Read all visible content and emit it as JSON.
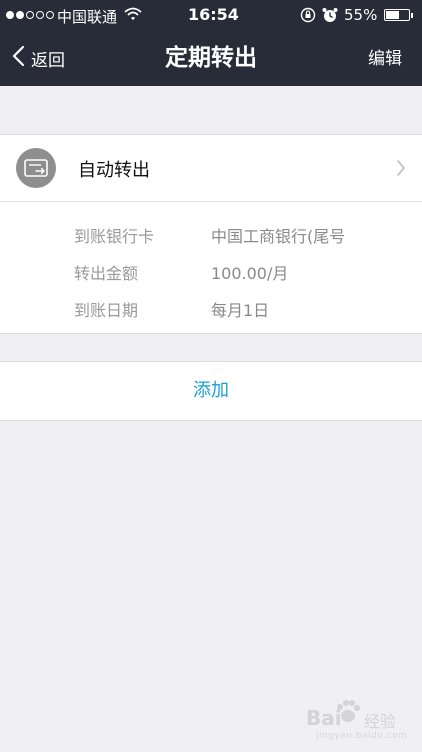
{
  "status_bar": {
    "carrier": "中国联通",
    "time": "16:54",
    "battery_percent_label": "55%",
    "battery_level": 0.55,
    "signal_bars_filled": 2,
    "signal_bars_total": 5
  },
  "nav": {
    "back_label": "返回",
    "title": "定期转出",
    "edit_label": "编辑"
  },
  "transfer_card": {
    "title": "自动转出",
    "icon": "card-transfer-icon",
    "details": [
      {
        "label": "到账银行卡",
        "value": "中国工商银行(尾号"
      },
      {
        "label": "转出金额",
        "value": "100.00/月"
      },
      {
        "label": "到账日期",
        "value": "每月1日"
      }
    ]
  },
  "add_button": {
    "label": "添加"
  },
  "watermark": {
    "brand": "Bai",
    "brand_suffix": "经验",
    "url": "jingyan.baidu.com"
  },
  "colors": {
    "header_bg": "#272c38",
    "page_bg": "#efeff4",
    "accent": "#1ba0d6",
    "icon_bg": "#8e8e8e"
  }
}
